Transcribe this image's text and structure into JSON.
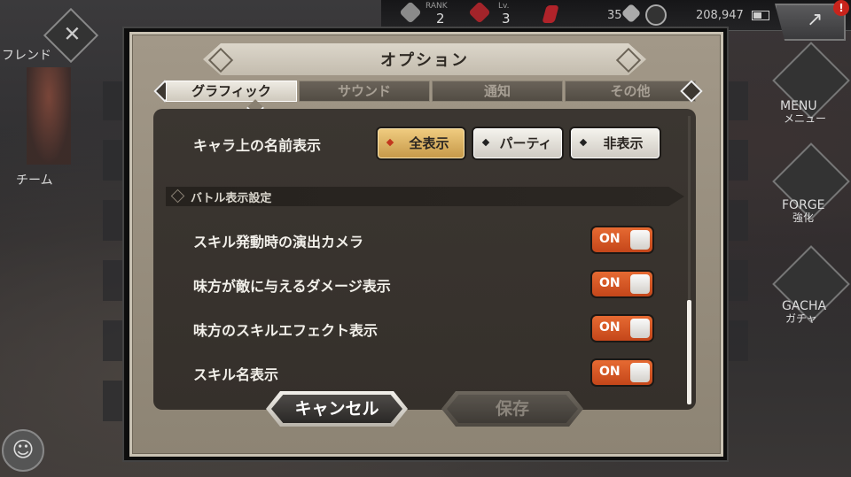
{
  "hud": {
    "rank_label": "RANK",
    "rank_value": "2",
    "lv_label": "Lv.",
    "lv_value": "3",
    "stones": "35",
    "coins": "208,947",
    "notification_count": "!"
  },
  "left_menu": {
    "friends": "フレンド",
    "team": "チーム"
  },
  "right_menu": {
    "menu_en": "MENU",
    "menu_jp": "メニュー",
    "forge_en": "FORGE",
    "forge_jp": "強化",
    "gacha_en": "GACHA",
    "gacha_jp": "ガチャ"
  },
  "dialog": {
    "title": "オプション",
    "tabs": [
      "グラフィック",
      "サウンド",
      "通知",
      "その他"
    ],
    "active_tab": "グラフィック",
    "name_display": {
      "label": "キャラ上の名前表示",
      "options": [
        "全表示",
        "パーティ",
        "非表示"
      ],
      "selected": "全表示"
    },
    "section_title": "バトル表示設定",
    "settings": [
      {
        "label": "スキル発動時の演出カメラ",
        "state": "ON"
      },
      {
        "label": "味方が敵に与えるダメージ表示",
        "state": "ON"
      },
      {
        "label": "味方のスキルエフェクト表示",
        "state": "ON"
      },
      {
        "label": "スキル名表示",
        "state": "ON"
      }
    ],
    "cancel_label": "キャンセル",
    "save_label": "保存"
  },
  "colors": {
    "toggle_on": "#e0592a",
    "selected_option": "#e2b868",
    "dialog_bg": "#968d7d",
    "panel_bg": "#38332e"
  }
}
